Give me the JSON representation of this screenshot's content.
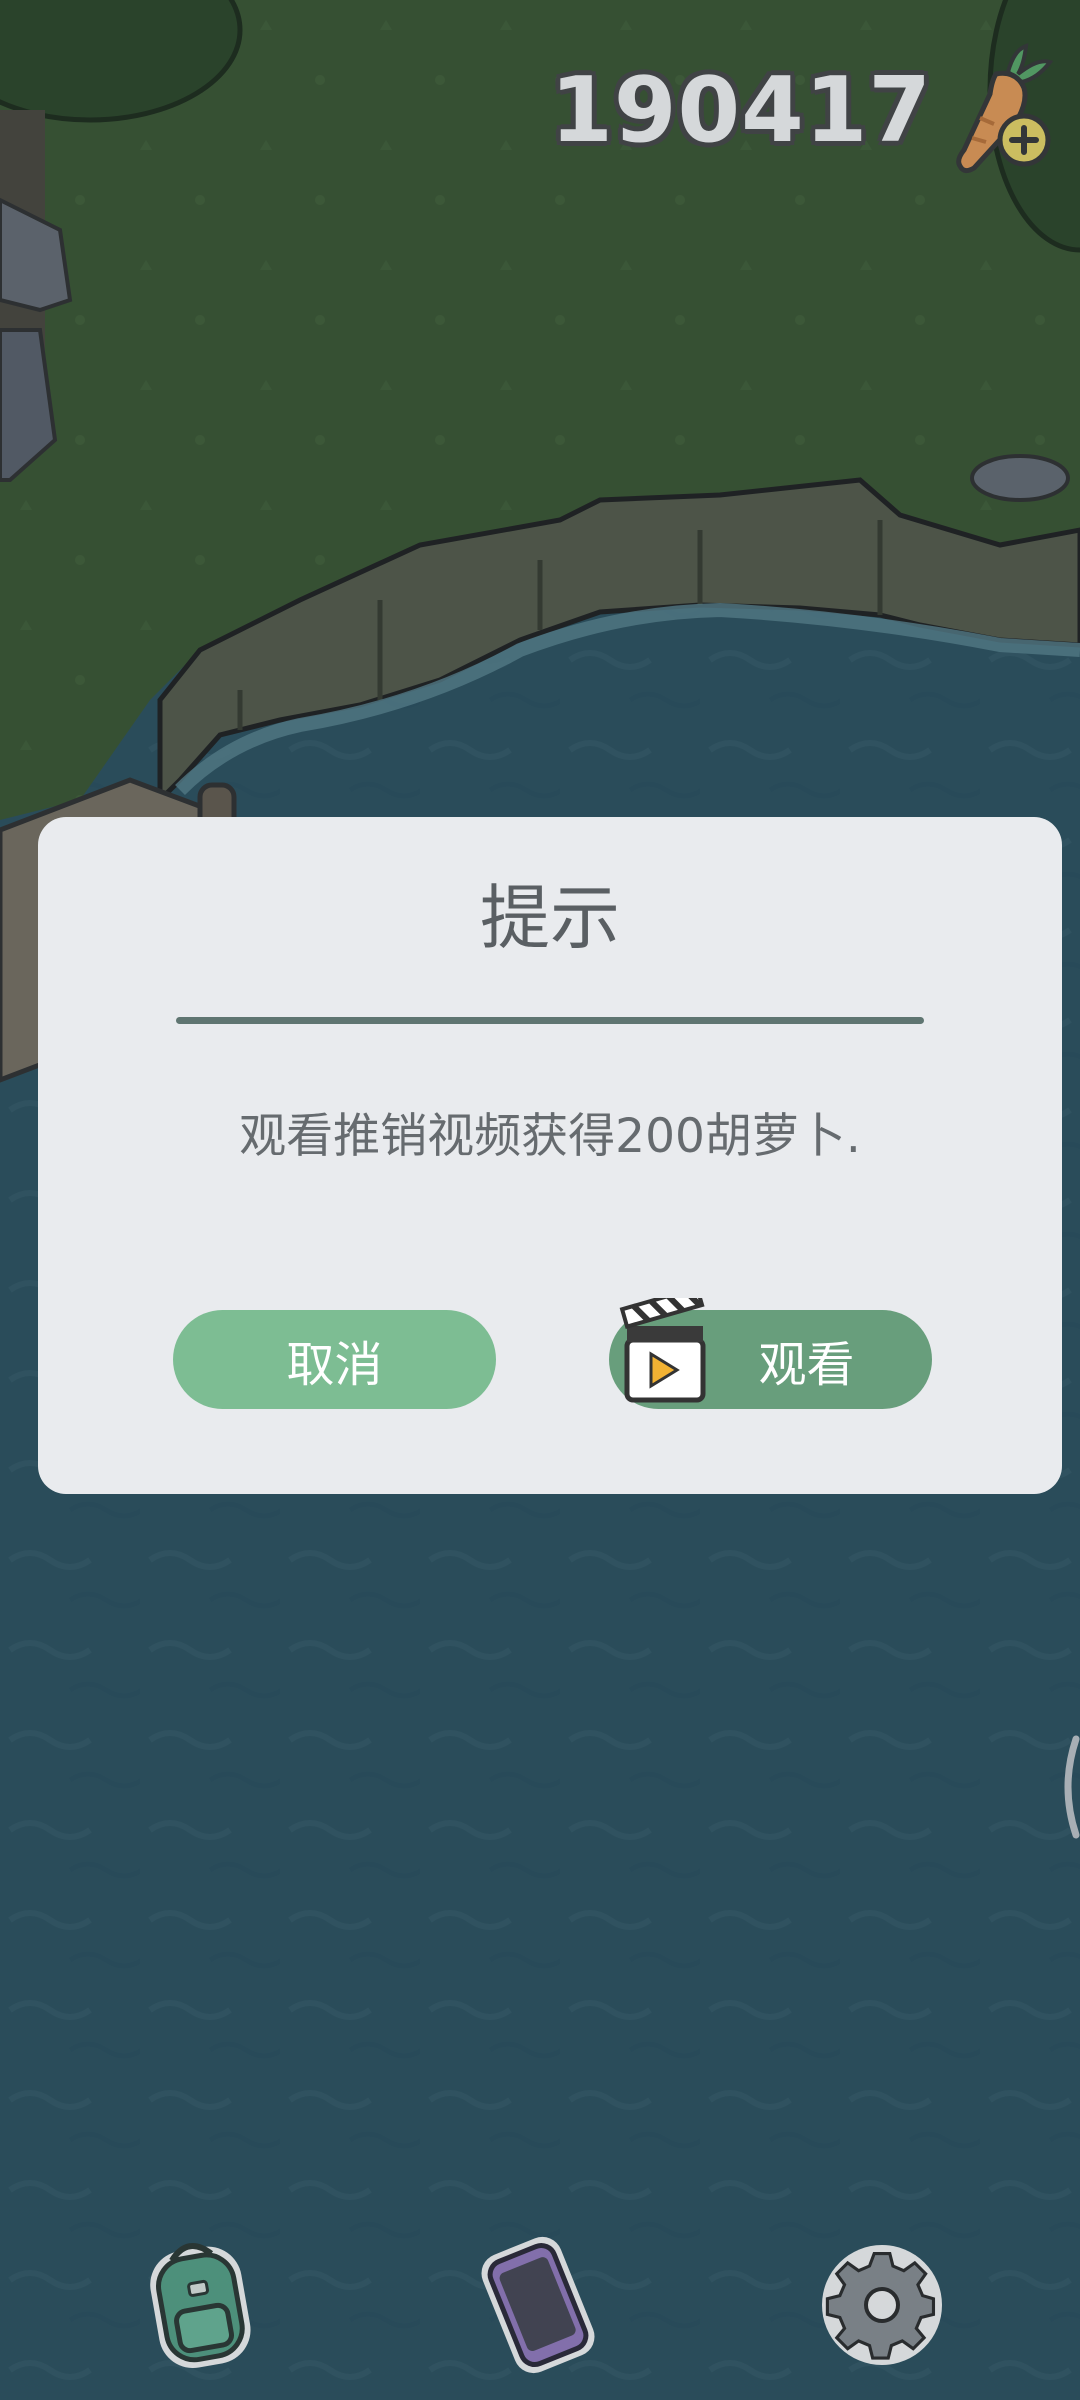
{
  "hud": {
    "carrot_count": "190417",
    "carrot_icon": "carrot-add-icon"
  },
  "dialog": {
    "title": "提示",
    "message": "观看推销视频获得200胡萝卜.",
    "cancel_label": "取消",
    "watch_label": "观看",
    "watch_icon": "video-clapperboard-icon"
  },
  "bottom_nav": {
    "items": [
      {
        "icon": "backpack-icon"
      },
      {
        "icon": "phone-icon"
      },
      {
        "icon": "settings-gear-icon"
      }
    ]
  },
  "colors": {
    "grass": "#3e5a34",
    "water": "#2f5563",
    "dialog_bg": "#e9ebee",
    "cancel_button": "#7dbd93",
    "watch_button": "#689e7c",
    "divider": "#5f7571"
  }
}
